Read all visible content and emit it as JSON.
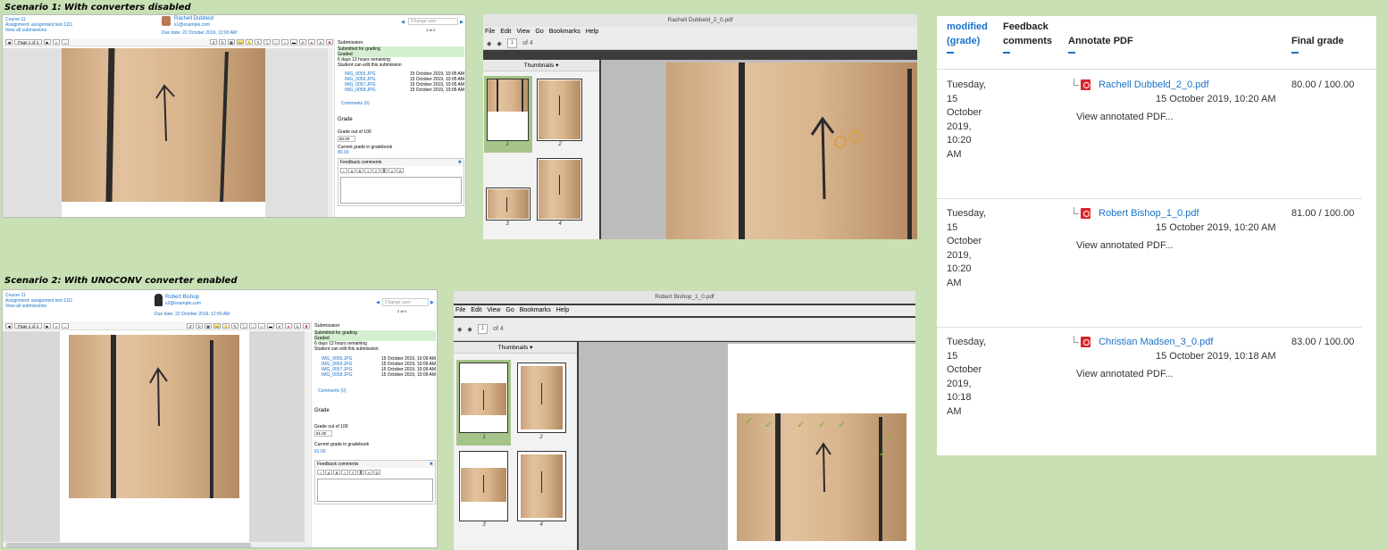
{
  "scenario1": {
    "title": "Scenario 1: With converters disabled",
    "moodle": {
      "course": "Course 11",
      "assignment": "Assignment: assignment test 1111",
      "view_all": "View all submissions",
      "user_name": "Rachell Dubbeld",
      "user_email": "s1@example.com",
      "due_date": "Due date: 22 October 2019, 12:00 AM",
      "change_user": "Change user",
      "user_count": "1 of 4",
      "page_select": "Page 1 of 4",
      "submission_label": "Submission",
      "status1": "Submitted for grading",
      "status2": "Graded",
      "time_remaining": "6 days 13 hours remaining",
      "can_edit": "Student can edit this submission",
      "files": [
        {
          "name": "IMG_0055.JPG",
          "date": "15 October 2019, 10:05 AM"
        },
        {
          "name": "IMG_0056.JPG",
          "date": "15 October 2019, 10:05 AM"
        },
        {
          "name": "IMG_0057.JPG",
          "date": "15 October 2019, 10:05 AM"
        },
        {
          "name": "IMG_0058.JPG",
          "date": "15 October 2019, 10:05 AM"
        }
      ],
      "comments": "Comments (0)",
      "grade_heading": "Grade",
      "grade_out_of": "Grade out of 100",
      "grade_value": "80.00",
      "current_grade_label": "Current grade in gradebook",
      "current_grade": "80.00",
      "feedback_label": "Feedback comments"
    },
    "viewer": {
      "title": "Rachell Dubbeld_2_0.pdf",
      "menu": [
        "File",
        "Edit",
        "View",
        "Go",
        "Bookmarks",
        "Help"
      ],
      "page_num": "1",
      "page_of": "of 4",
      "thumbnails_label": "Thumbnails",
      "thumb_nums": [
        "1",
        "2",
        "3",
        "4"
      ]
    }
  },
  "scenario2": {
    "title": "Scenario 2: With UNOCONV converter enabled",
    "moodle": {
      "course": "Course 11",
      "assignment": "Assignment: assignment test 1111",
      "view_all": "View all submissions",
      "user_name": "Robert Bishop",
      "user_email": "s2@example.com",
      "due_date": "Due date: 22 October 2019, 12:00 AM",
      "change_user": "Change user",
      "user_count": "2 of 4",
      "page_select": "Page 1 of 4",
      "submission_label": "Submission",
      "status1": "Submitted for grading",
      "status2": "Graded",
      "time_remaining": "6 days 13 hours remaining",
      "can_edit": "Student can edit this submission",
      "files": [
        {
          "name": "IMG_0055.JPG",
          "date": "15 October 2019, 10:09 AM"
        },
        {
          "name": "IMG_0056.JPG",
          "date": "15 October 2019, 10:09 AM"
        },
        {
          "name": "IMG_0057.JPG",
          "date": "15 October 2019, 10:09 AM"
        },
        {
          "name": "IMG_0058.JPG",
          "date": "15 October 2019, 10:09 AM"
        }
      ],
      "comments": "Comments (0)",
      "grade_heading": "Grade",
      "grade_out_of": "Grade out of 100",
      "grade_value": "81.00",
      "current_grade_label": "Current grade in gradebook",
      "current_grade": "81.00",
      "feedback_label": "Feedback comments"
    },
    "viewer": {
      "title": "Robert Bishop_1_0.pdf",
      "menu": [
        "File",
        "Edit",
        "View",
        "Go",
        "Bookmarks",
        "Help"
      ],
      "page_num": "1",
      "page_of": "of 4",
      "thumbnails_label": "Thumbnails",
      "thumb_nums": [
        "1",
        "2",
        "3",
        "4"
      ]
    }
  },
  "grade_table": {
    "headers": {
      "modified_line1": "modified",
      "modified_line2": "(grade)",
      "feedback_line1": "Feedback",
      "feedback_line2": "comments",
      "annotate": "Annotate PDF",
      "final_grade": "Final grade"
    },
    "rows": [
      {
        "modified": [
          "Tuesday,",
          "15",
          "October",
          "2019,",
          "10:20",
          "AM"
        ],
        "pdf_name": "Rachell Dubbeld_2_0.pdf",
        "pdf_date": "15 October 2019, 10:20 AM",
        "view_link": "View annotated PDF...",
        "grade": "80.00 / 100.00"
      },
      {
        "modified": [
          "Tuesday,",
          "15",
          "October",
          "2019,",
          "10:20",
          "AM"
        ],
        "pdf_name": "Robert Bishop_1_0.pdf",
        "pdf_date": "15 October 2019, 10:20 AM",
        "view_link": "View annotated PDF...",
        "grade": "81.00 / 100.00"
      },
      {
        "modified": [
          "Tuesday,",
          "15",
          "October",
          "2019,",
          "10:18",
          "AM"
        ],
        "pdf_name": "Christian Madsen_3_0.pdf",
        "pdf_date": "15 October 2019, 10:18 AM",
        "view_link": "View annotated PDF...",
        "grade": "83.00 / 100.00"
      }
    ]
  },
  "colors": {
    "background": "#c8e0b4",
    "link": "#1a73c8",
    "graded_green": "#d4eed0",
    "thumb_selected": "#a6c48a",
    "pdf_red": "#d9262c"
  }
}
